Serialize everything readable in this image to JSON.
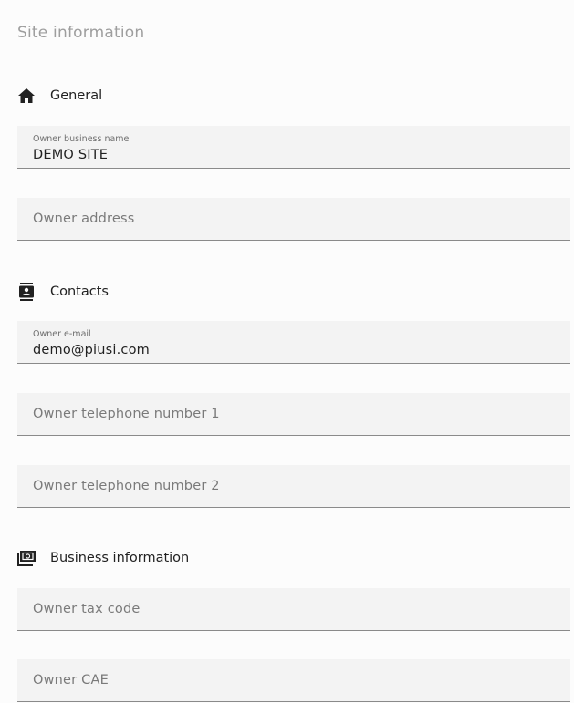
{
  "page": {
    "title": "Site information"
  },
  "sections": {
    "general": {
      "label": "General",
      "icon": "home-icon"
    },
    "contacts": {
      "label": "Contacts",
      "icon": "contact-book-icon"
    },
    "business": {
      "label": "Business information",
      "icon": "money-icon"
    }
  },
  "fields": {
    "owner_business_name": {
      "label": "Owner business name",
      "value": "DEMO SITE"
    },
    "owner_address": {
      "placeholder": "Owner address",
      "value": ""
    },
    "owner_email": {
      "label": "Owner e-mail",
      "value": "demo@piusi.com"
    },
    "owner_tel_1": {
      "placeholder": "Owner telephone number 1",
      "value": ""
    },
    "owner_tel_2": {
      "placeholder": "Owner telephone number 2",
      "value": ""
    },
    "owner_tax_code": {
      "placeholder": "Owner tax code",
      "value": ""
    },
    "owner_cae": {
      "placeholder": "Owner CAE",
      "value": ""
    }
  }
}
